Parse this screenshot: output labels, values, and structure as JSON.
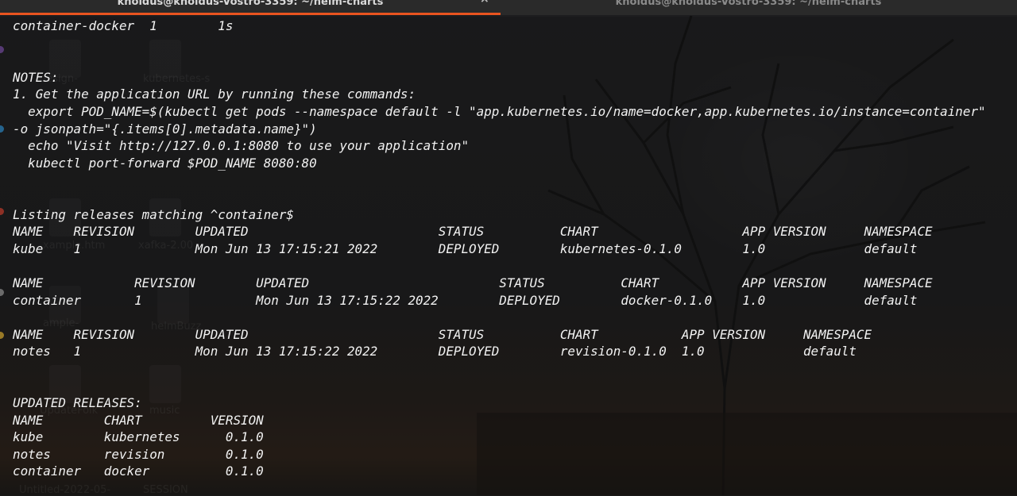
{
  "window": {
    "tabs": [
      {
        "title": "knoldus@knoldus-Vostro-3359: ~/helm-charts",
        "active": true
      },
      {
        "title": "knoldus@knoldus-Vostro-3359: ~/helm-charts",
        "active": false
      }
    ],
    "close_glyph": "×",
    "accent_color": "#e95420"
  },
  "terminal": {
    "lines": [
      "container-docker  1        1s",
      "",
      "",
      "NOTES:",
      "1. Get the application URL by running these commands:",
      "  export POD_NAME=$(kubectl get pods --namespace default -l \"app.kubernetes.io/name=docker,app.kubernetes.io/instance=container\"",
      "-o jsonpath=\"{.items[0].metadata.name}\")",
      "  echo \"Visit http://127.0.0.1:8080 to use your application\"",
      "  kubectl port-forward $POD_NAME 8080:80",
      "",
      "",
      "Listing releases matching ^container$",
      "NAME    REVISION        UPDATED                         STATUS          CHART                   APP VERSION     NAMESPACE",
      "kube    1               Mon Jun 13 17:15:21 2022        DEPLOYED        kubernetes-0.1.0        1.0             default",
      "",
      "NAME            REVISION        UPDATED                         STATUS          CHART           APP VERSION     NAMESPACE",
      "container       1               Mon Jun 13 17:15:22 2022        DEPLOYED        docker-0.1.0    1.0             default",
      "",
      "NAME    REVISION        UPDATED                         STATUS          CHART           APP VERSION     NAMESPACE",
      "notes   1               Mon Jun 13 17:15:22 2022        DEPLOYED        revision-0.1.0  1.0             default",
      "",
      "",
      "UPDATED RELEASES:",
      "NAME        CHART         VERSION",
      "kube        kubernetes      0.1.0",
      "notes       revision        0.1.0",
      "container   docker          0.1.0"
    ]
  },
  "desktop": {
    "icon_labels": [
      "design-",
      "kubernetes-s",
      "xample.htm",
      "xafka-2.00",
      "ample-",
      "helmBuzz",
      "UpdateFolk",
      "music",
      "Untitled-2022-05-",
      "SESSION"
    ]
  }
}
